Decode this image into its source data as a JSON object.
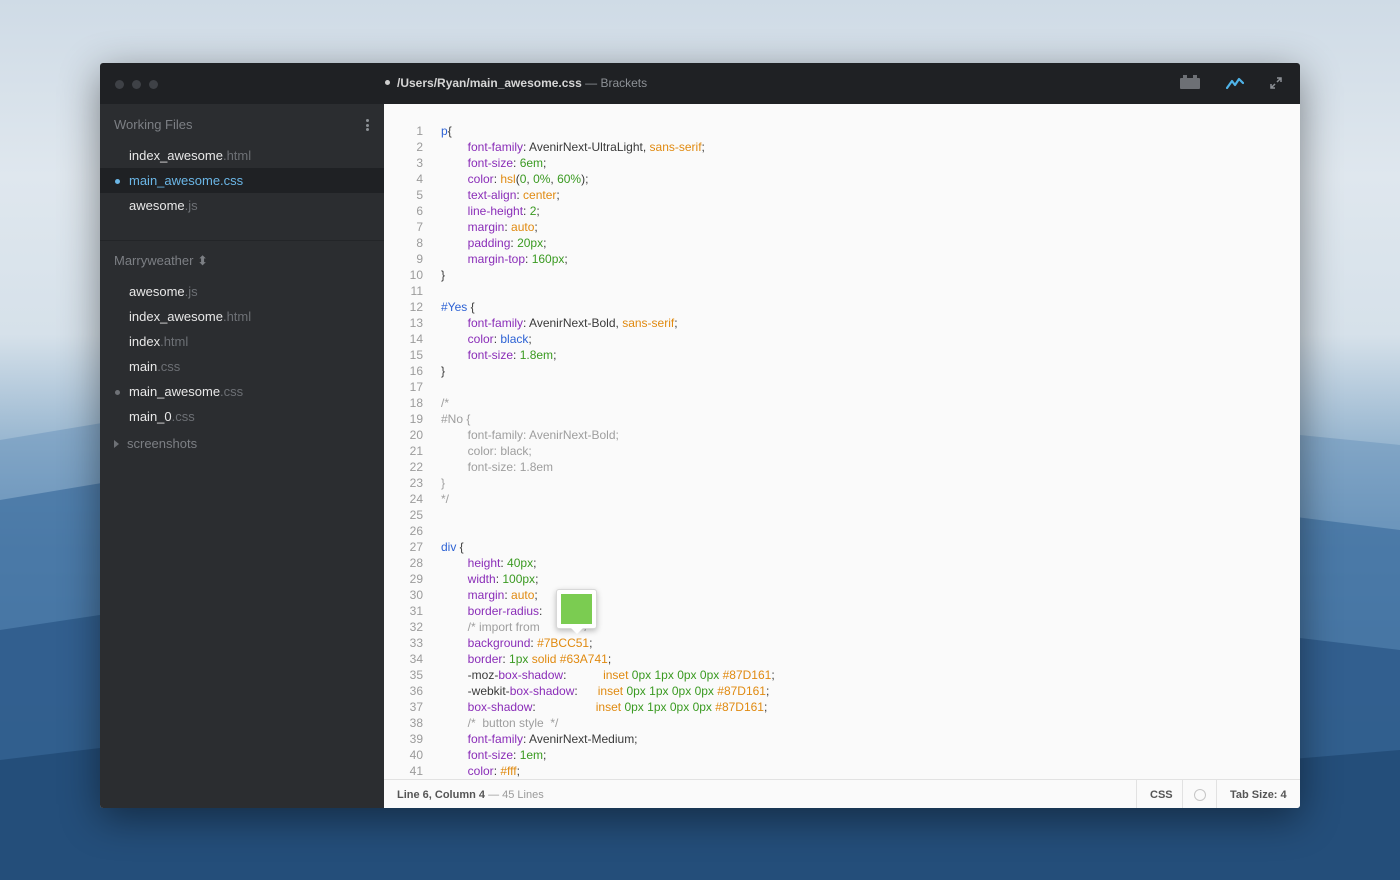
{
  "window": {
    "file_path": "/Users/Ryan/main_awesome.css",
    "app_suffix": " — Brackets"
  },
  "toolbar": {
    "icons": [
      "extension-manager-icon",
      "live-preview-icon",
      "expand-icon"
    ],
    "accent_color": "#4fb3e8"
  },
  "sidebar": {
    "working_files_label": "Working Files",
    "working_files": [
      {
        "name": "index_awesome",
        "ext": ".html",
        "active": false,
        "dirty": false
      },
      {
        "name": "main_awesome",
        "ext": ".css",
        "active": true,
        "dirty": true
      },
      {
        "name": "awesome",
        "ext": ".js",
        "active": false,
        "dirty": false
      }
    ],
    "project_label": "Marryweather ⬍",
    "project_files": [
      {
        "name": "awesome",
        "ext": ".js",
        "dirty": false
      },
      {
        "name": "index_awesome",
        "ext": ".html",
        "dirty": false
      },
      {
        "name": "index",
        "ext": ".html",
        "dirty": false
      },
      {
        "name": "main",
        "ext": ".css",
        "dirty": false
      },
      {
        "name": "main_awesome",
        "ext": ".css",
        "dirty": true
      },
      {
        "name": "main_0",
        "ext": ".css",
        "dirty": false
      }
    ],
    "folder_label": "screenshots"
  },
  "editor": {
    "lines": [
      [
        [
          "sel",
          "p"
        ],
        [
          "",
          "{"
        ]
      ],
      [
        [
          "",
          "        "
        ],
        [
          "prop",
          "font-family"
        ],
        [
          "",
          ": AvenirNext-UltraLight, "
        ],
        [
          "kw",
          "sans-serif"
        ],
        [
          "",
          ";"
        ]
      ],
      [
        [
          "",
          "        "
        ],
        [
          "prop",
          "font-size"
        ],
        [
          "",
          ": "
        ],
        [
          "num",
          "6em"
        ],
        [
          "",
          ";"
        ]
      ],
      [
        [
          "",
          "        "
        ],
        [
          "prop",
          "color"
        ],
        [
          "",
          ": "
        ],
        [
          "kw",
          "hsl"
        ],
        [
          "",
          "("
        ],
        [
          "num",
          "0"
        ],
        [
          "",
          ", "
        ],
        [
          "num",
          "0%"
        ],
        [
          "",
          ", "
        ],
        [
          "num",
          "60%"
        ],
        [
          "",
          ");"
        ]
      ],
      [
        [
          "",
          "        "
        ],
        [
          "prop",
          "text-align"
        ],
        [
          "",
          ": "
        ],
        [
          "kw",
          "center"
        ],
        [
          "",
          ";"
        ]
      ],
      [
        [
          "",
          "        "
        ],
        [
          "prop",
          "line-height"
        ],
        [
          "",
          ": "
        ],
        [
          "num",
          "2"
        ],
        [
          "",
          ";"
        ]
      ],
      [
        [
          "",
          "        "
        ],
        [
          "prop",
          "margin"
        ],
        [
          "",
          ": "
        ],
        [
          "kw",
          "auto"
        ],
        [
          "",
          ";"
        ]
      ],
      [
        [
          "",
          "        "
        ],
        [
          "prop",
          "padding"
        ],
        [
          "",
          ": "
        ],
        [
          "num",
          "20px"
        ],
        [
          "",
          ";"
        ]
      ],
      [
        [
          "",
          "        "
        ],
        [
          "prop",
          "margin-top"
        ],
        [
          "",
          ": "
        ],
        [
          "num",
          "160px"
        ],
        [
          "",
          ";"
        ]
      ],
      [
        [
          "",
          "}"
        ]
      ],
      [
        [
          "",
          ""
        ]
      ],
      [
        [
          "sel",
          "#Yes"
        ],
        [
          "",
          " {"
        ]
      ],
      [
        [
          "",
          "        "
        ],
        [
          "prop",
          "font-family"
        ],
        [
          "",
          ": AvenirNext-Bold, "
        ],
        [
          "kw",
          "sans-serif"
        ],
        [
          "",
          ";"
        ]
      ],
      [
        [
          "",
          "        "
        ],
        [
          "prop",
          "color"
        ],
        [
          "",
          ": "
        ],
        [
          "blue",
          "black"
        ],
        [
          "",
          ";"
        ]
      ],
      [
        [
          "",
          "        "
        ],
        [
          "prop",
          "font-size"
        ],
        [
          "",
          ": "
        ],
        [
          "num",
          "1.8em"
        ],
        [
          "",
          ";"
        ]
      ],
      [
        [
          "",
          "}"
        ]
      ],
      [
        [
          "",
          ""
        ]
      ],
      [
        [
          "com",
          "/*"
        ]
      ],
      [
        [
          "com",
          "#No {"
        ]
      ],
      [
        [
          "com",
          "        font-family: AvenirNext-Bold;"
        ]
      ],
      [
        [
          "com",
          "        color: black;"
        ]
      ],
      [
        [
          "com",
          "        font-size: 1.8em"
        ]
      ],
      [
        [
          "com",
          "}"
        ]
      ],
      [
        [
          "com",
          "*/"
        ]
      ],
      [
        [
          "",
          ""
        ]
      ],
      [
        [
          "",
          ""
        ]
      ],
      [
        [
          "sel",
          "div"
        ],
        [
          "",
          " {"
        ]
      ],
      [
        [
          "",
          "        "
        ],
        [
          "prop",
          "height"
        ],
        [
          "",
          ": "
        ],
        [
          "num",
          "40px"
        ],
        [
          "",
          ";"
        ]
      ],
      [
        [
          "",
          "        "
        ],
        [
          "prop",
          "width"
        ],
        [
          "",
          ": "
        ],
        [
          "num",
          "100px"
        ],
        [
          "",
          ";"
        ]
      ],
      [
        [
          "",
          "        "
        ],
        [
          "prop",
          "margin"
        ],
        [
          "",
          ": "
        ],
        [
          "kw",
          "auto"
        ],
        [
          "",
          ";"
        ]
      ],
      [
        [
          "",
          "        "
        ],
        [
          "prop",
          "border-radius"
        ],
        [
          "",
          ":"
        ]
      ],
      [
        [
          "com",
          "        /* import from"
        ],
        [
          "com",
          "          : */"
        ]
      ],
      [
        [
          "",
          "        "
        ],
        [
          "prop",
          "background"
        ],
        [
          "",
          ": "
        ],
        [
          "kw",
          "#7BCC51"
        ],
        [
          "",
          ";"
        ]
      ],
      [
        [
          "",
          "        "
        ],
        [
          "prop",
          "border"
        ],
        [
          "",
          ": "
        ],
        [
          "num",
          "1px"
        ],
        [
          "",
          " "
        ],
        [
          "kw",
          "solid"
        ],
        [
          "",
          " "
        ],
        [
          "kw",
          "#63A741"
        ],
        [
          "",
          ";"
        ]
      ],
      [
        [
          "",
          "        -moz-"
        ],
        [
          "prop",
          "box-shadow"
        ],
        [
          "",
          ":           "
        ],
        [
          "kw",
          "inset"
        ],
        [
          "",
          " "
        ],
        [
          "num",
          "0px"
        ],
        [
          "",
          " "
        ],
        [
          "num",
          "1px"
        ],
        [
          "",
          " "
        ],
        [
          "num",
          "0px"
        ],
        [
          "",
          " "
        ],
        [
          "num",
          "0px"
        ],
        [
          "",
          " "
        ],
        [
          "kw",
          "#87D161"
        ],
        [
          "",
          ";"
        ]
      ],
      [
        [
          "",
          "        -webkit-"
        ],
        [
          "prop",
          "box-shadow"
        ],
        [
          "",
          ":      "
        ],
        [
          "kw",
          "inset"
        ],
        [
          "",
          " "
        ],
        [
          "num",
          "0px"
        ],
        [
          "",
          " "
        ],
        [
          "num",
          "1px"
        ],
        [
          "",
          " "
        ],
        [
          "num",
          "0px"
        ],
        [
          "",
          " "
        ],
        [
          "num",
          "0px"
        ],
        [
          "",
          " "
        ],
        [
          "kw",
          "#87D161"
        ],
        [
          "",
          ";"
        ]
      ],
      [
        [
          "",
          "        "
        ],
        [
          "prop",
          "box-shadow"
        ],
        [
          "",
          ":                  "
        ],
        [
          "kw",
          "inset"
        ],
        [
          "",
          " "
        ],
        [
          "num",
          "0px"
        ],
        [
          "",
          " "
        ],
        [
          "num",
          "1px"
        ],
        [
          "",
          " "
        ],
        [
          "num",
          "0px"
        ],
        [
          "",
          " "
        ],
        [
          "num",
          "0px"
        ],
        [
          "",
          " "
        ],
        [
          "kw",
          "#87D161"
        ],
        [
          "",
          ";"
        ]
      ],
      [
        [
          "com",
          "        /*  button style  */"
        ]
      ],
      [
        [
          "",
          "        "
        ],
        [
          "prop",
          "font-family"
        ],
        [
          "",
          ": AvenirNext-Medium;"
        ]
      ],
      [
        [
          "",
          "        "
        ],
        [
          "prop",
          "font-size"
        ],
        [
          "",
          ": "
        ],
        [
          "num",
          "1em"
        ],
        [
          "",
          ";"
        ]
      ],
      [
        [
          "",
          "        "
        ],
        [
          "prop",
          "color"
        ],
        [
          "",
          ": "
        ],
        [
          "kw",
          "#fff"
        ],
        [
          "",
          ";"
        ]
      ]
    ],
    "color_preview": "#7BCC51"
  },
  "statusbar": {
    "position": "Line 6, Column 4",
    "line_count": " — 45 Lines",
    "language": "CSS",
    "tab_size": "Tab Size: 4"
  }
}
